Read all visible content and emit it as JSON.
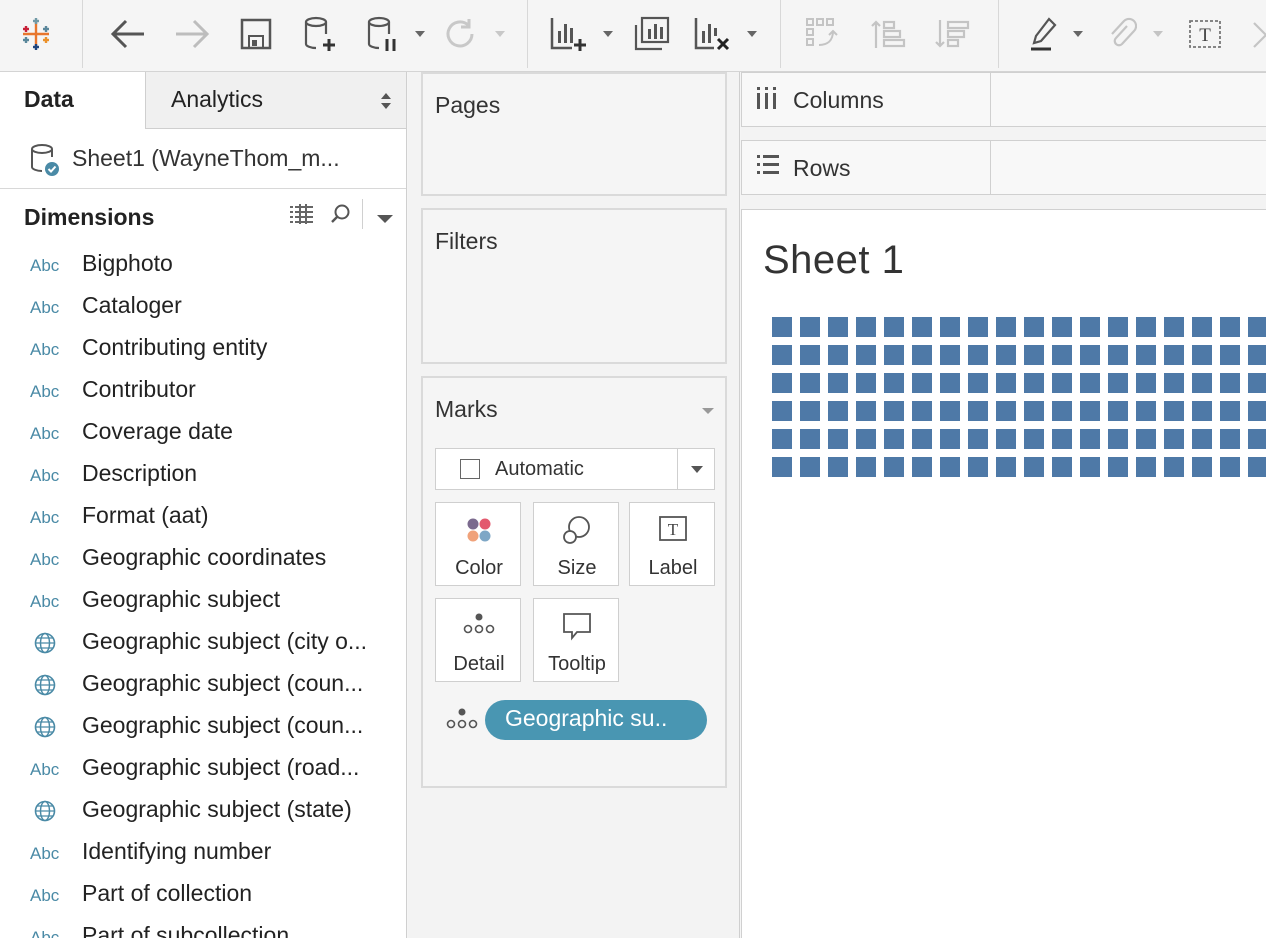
{
  "app": {
    "logo": "tableau-logo",
    "toolbar": [
      {
        "name": "back-icon",
        "enabled": true
      },
      {
        "name": "forward-icon",
        "enabled": false
      },
      {
        "name": "save-icon",
        "enabled": true
      },
      {
        "name": "new-data-source-icon",
        "enabled": true
      },
      {
        "name": "pause-auto-updates-icon",
        "enabled": true
      },
      {
        "name": "refresh-icon",
        "enabled": false
      },
      {
        "name": "new-worksheet-icon",
        "enabled": true
      },
      {
        "name": "duplicate-sheet-icon",
        "enabled": true
      },
      {
        "name": "clear-sheet-icon",
        "enabled": true
      },
      {
        "name": "swap-icon",
        "enabled": false
      },
      {
        "name": "sort-ascending-icon",
        "enabled": false
      },
      {
        "name": "sort-descending-icon",
        "enabled": false
      },
      {
        "name": "highlight-icon",
        "enabled": true
      },
      {
        "name": "group-members-icon",
        "enabled": false
      },
      {
        "name": "show-mark-labels-icon",
        "enabled": true
      }
    ],
    "accent_color": "#4e79a7"
  },
  "data_pane": {
    "tab_data": "Data",
    "tab_analytics": "Analytics",
    "data_source": "Sheet1 (WayneThom_m...",
    "dimensions_title": "Dimensions",
    "dimensions": [
      {
        "type": "Abc",
        "name": "Bigphoto"
      },
      {
        "type": "Abc",
        "name": "Cataloger"
      },
      {
        "type": "Abc",
        "name": "Contributing entity"
      },
      {
        "type": "Abc",
        "name": "Contributor"
      },
      {
        "type": "Abc",
        "name": "Coverage date"
      },
      {
        "type": "Abc",
        "name": "Description"
      },
      {
        "type": "Abc",
        "name": "Format (aat)"
      },
      {
        "type": "Abc",
        "name": "Geographic coordinates"
      },
      {
        "type": "Abc",
        "name": "Geographic subject"
      },
      {
        "type": "globe",
        "name": "Geographic subject (city o..."
      },
      {
        "type": "globe",
        "name": "Geographic subject (coun..."
      },
      {
        "type": "globe",
        "name": "Geographic subject (coun..."
      },
      {
        "type": "Abc",
        "name": "Geographic subject (road..."
      },
      {
        "type": "globe",
        "name": "Geographic subject (state)"
      },
      {
        "type": "Abc",
        "name": "Identifying number"
      },
      {
        "type": "Abc",
        "name": "Part of collection"
      },
      {
        "type": "Abc",
        "name": "Part of subcollection"
      }
    ]
  },
  "cards": {
    "pages": "Pages",
    "filters": "Filters",
    "marks": "Marks",
    "mark_type": "Automatic",
    "buttons": {
      "color": "Color",
      "size": "Size",
      "label": "Label",
      "detail": "Detail",
      "tooltip": "Tooltip"
    },
    "detail_pill": "Geographic su.."
  },
  "shelves": {
    "columns": "Columns",
    "rows": "Rows"
  },
  "view": {
    "sheet_title": "Sheet 1",
    "mark_color": "#4e79a7",
    "mark_rows": 6,
    "mark_cols_visible": 18
  }
}
